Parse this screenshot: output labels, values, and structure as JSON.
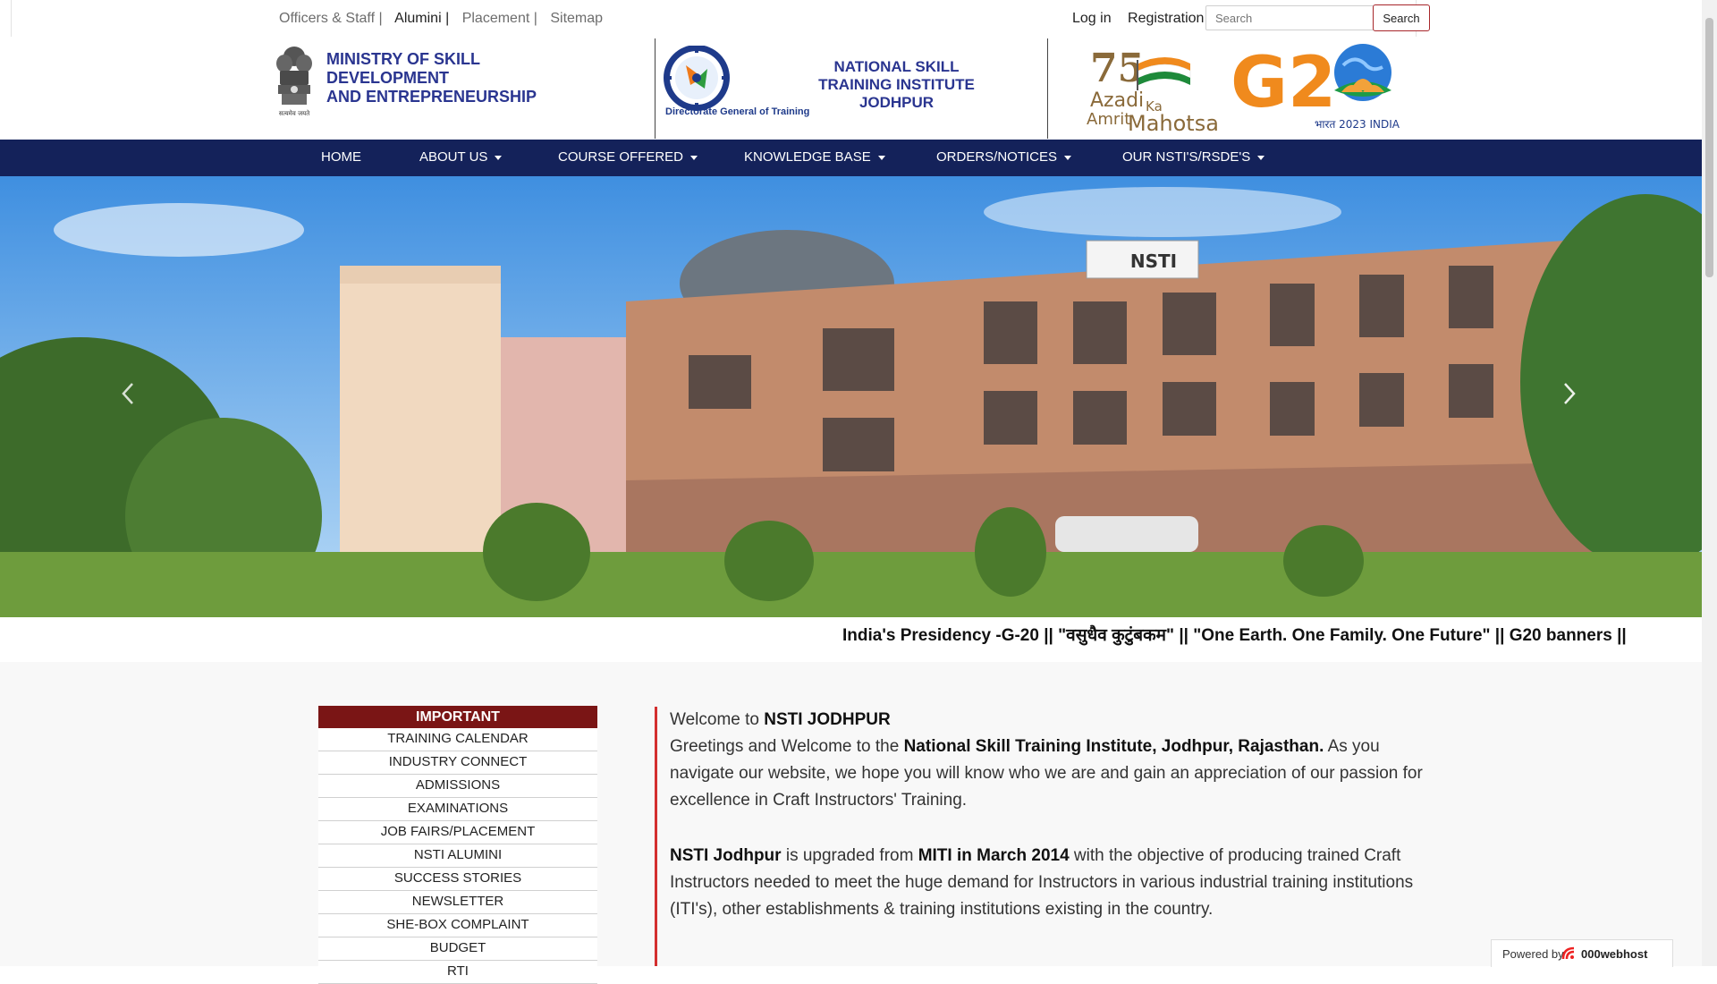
{
  "topbar": {
    "links": [
      "Officers & Staff |",
      "Alumini |",
      "Placement |",
      "Sitemap"
    ],
    "login": "Log in",
    "registration": "Registration",
    "search_placeholder": "Search",
    "search_button": "Search"
  },
  "header": {
    "ministry_line1": "MINISTRY OF SKILL",
    "ministry_line2": "DEVELOPMENT",
    "ministry_line3": "AND ENTREPRENEURSHIP",
    "emblem_caption": "सत्यमेव जयते",
    "dgt_caption": "Directorate General of Training",
    "institute_line1": "NATIONAL SKILL",
    "institute_line2": "TRAINING INSTITUTE",
    "institute_line3": "JODHPUR",
    "azadi_line1": "Azadi",
    "azadi_ka": "Ka",
    "azadi_line2": "Amrit",
    "azadi_line3": "Mahotsav",
    "g20_caption": "भारत 2023 INDIA"
  },
  "nav": {
    "items": [
      {
        "label": "HOME",
        "dropdown": false
      },
      {
        "label": "ABOUT US",
        "dropdown": true
      },
      {
        "label": "COURSE OFFERED",
        "dropdown": true
      },
      {
        "label": "KNOWLEDGE BASE",
        "dropdown": true
      },
      {
        "label": "ORDERS/NOTICES",
        "dropdown": true
      },
      {
        "label": "OUR NSTI'S/RSDE'S",
        "dropdown": true
      }
    ]
  },
  "hero": {
    "sign_text": "NSTI",
    "prev_icon": "chevron-left-icon",
    "next_icon": "chevron-right-icon"
  },
  "ticker": {
    "text": "India's Presidency -G-20   ||  \"वसुधैव कुटुंबकम\"   || \"One Earth. One Family. One Future\" ||      G20 banners   ||"
  },
  "important": {
    "heading": "IMPORTANT",
    "items": [
      "TRAINING CALENDAR",
      "INDUSTRY CONNECT",
      "ADMISSIONS",
      "EXAMINATIONS",
      "JOB FAIRS/PLACEMENT",
      "NSTI ALUMINI",
      "SUCCESS STORIES",
      "NEWSLETTER",
      "SHE-BOX COMPLAINT",
      "BUDGET",
      "RTI"
    ]
  },
  "content": {
    "welcome_prefix": "Welcome to ",
    "welcome_bold": "NSTI JODHPUR",
    "p1_prefix": "Greetings and Welcome to the ",
    "p1_bold": "National Skill Training Institute, Jodhpur, Rajasthan.",
    "p1_rest": " As you navigate our website, we hope you will know who we are and gain an appreciation of our passion for excellence in Craft Instructors' Training.",
    "p2_bold1": "NSTI Jodhpur",
    "p2_mid1": " is upgraded from ",
    "p2_bold2": "MITI in March 2014",
    "p2_rest": " with the objective of producing trained Craft Instructors needed to meet the huge demand for Instructors in various industrial training institutions (ITI's), other establishments & training institutions existing in the country."
  },
  "footer": {
    "powered_by": "Powered by",
    "brand": "000webhost"
  },
  "colors": {
    "nav_bg": "#14225a",
    "important_bg": "#7a1515",
    "heading_blue": "#2a3590",
    "content_border": "#d32f2f"
  }
}
